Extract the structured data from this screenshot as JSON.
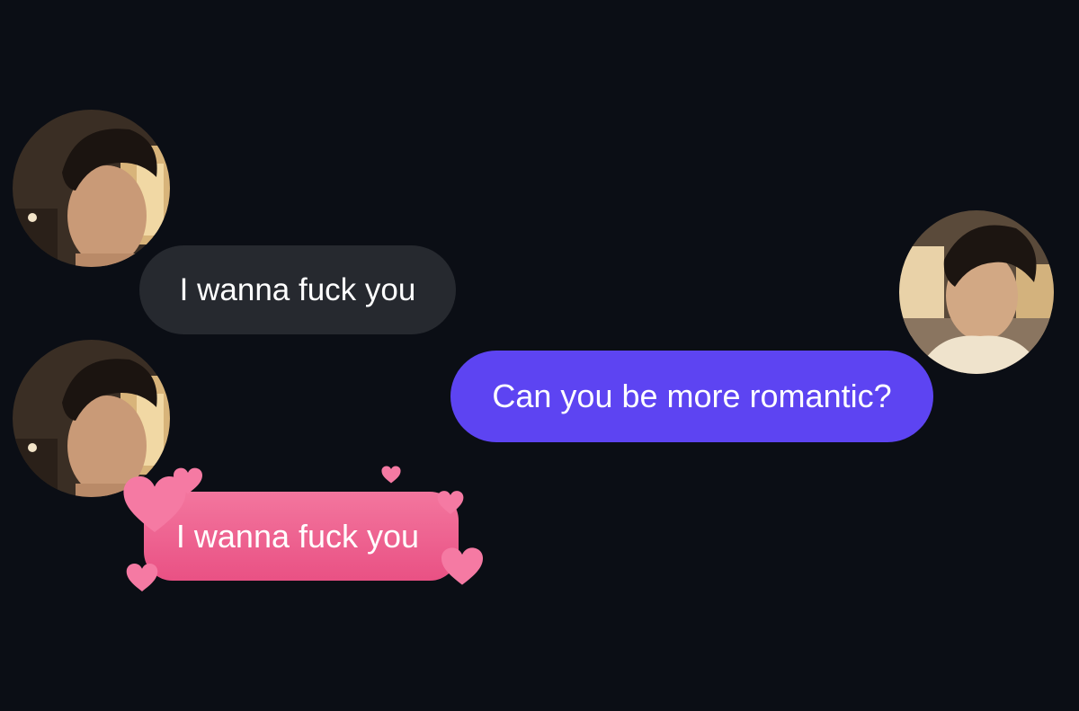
{
  "messages": [
    {
      "sender": "left",
      "text": "I wanna fuck you",
      "bubble_color": "#26292f"
    },
    {
      "sender": "right",
      "text": "Can you be more romantic?",
      "bubble_color": "#5d44f2"
    },
    {
      "sender": "left",
      "text": "I wanna fuck you",
      "bubble_color": "#ee6590",
      "effect": "hearts"
    }
  ],
  "colors": {
    "background": "#0b0e15",
    "gray_bubble": "#26292f",
    "purple_bubble": "#5d44f2",
    "pink_bubble": "#ee6590",
    "heart": "#f56f9c"
  },
  "icons": [
    "avatar-photo",
    "heart-icon"
  ]
}
